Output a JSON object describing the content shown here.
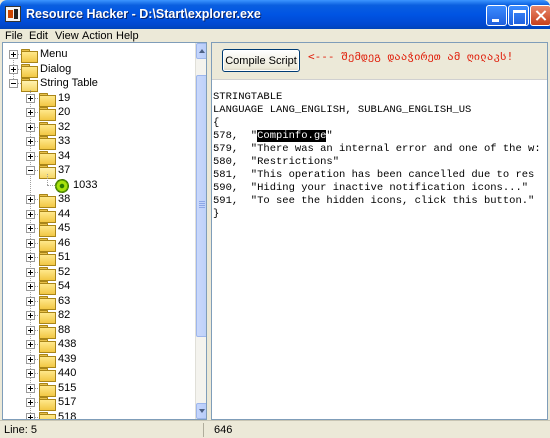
{
  "window": {
    "title": "Resource Hacker   -   D:\\Start\\explorer.exe"
  },
  "menu": [
    "File",
    "Edit",
    "View",
    "Action",
    "Help"
  ],
  "tree": {
    "top_items": [
      {
        "label": "Menu",
        "expanded": false
      },
      {
        "label": "Dialog",
        "expanded": false
      },
      {
        "label": "String Table",
        "expanded": true
      }
    ],
    "string_table_children": [
      {
        "label": "19"
      },
      {
        "label": "20"
      },
      {
        "label": "32"
      },
      {
        "label": "33"
      },
      {
        "label": "34"
      },
      {
        "label": "37",
        "expanded": true,
        "child": "1033"
      },
      {
        "label": "38"
      },
      {
        "label": "44"
      },
      {
        "label": "45"
      },
      {
        "label": "46"
      },
      {
        "label": "51"
      },
      {
        "label": "52"
      },
      {
        "label": "54"
      },
      {
        "label": "63"
      },
      {
        "label": "82"
      },
      {
        "label": "88"
      },
      {
        "label": "438"
      },
      {
        "label": "439"
      },
      {
        "label": "440"
      },
      {
        "label": "515"
      },
      {
        "label": "517"
      },
      {
        "label": "518"
      }
    ]
  },
  "toolbar": {
    "compile_label": "Compile Script",
    "annotation": "<---  შემდეგ  დააჭირეთ  ამ  ღილაკს!"
  },
  "script": {
    "lines": [
      "STRINGTABLE",
      "LANGUAGE LANG_ENGLISH, SUBLANG_ENGLISH_US",
      "{",
      "578,  \"Compinfo.ge\"",
      "579,  \"There was an internal error and one of the w:",
      "580,  \"Restrictions\"",
      "581,  \"This operation has been cancelled due to res",
      "590,  \"Hiding your inactive notification icons...\"",
      "591,  \"To see the hidden icons, click this button.\"",
      "}"
    ],
    "highlight_line": 3,
    "highlight_text": "Compinfo.ge"
  },
  "status": {
    "line": "Line: 5",
    "position": "646"
  }
}
